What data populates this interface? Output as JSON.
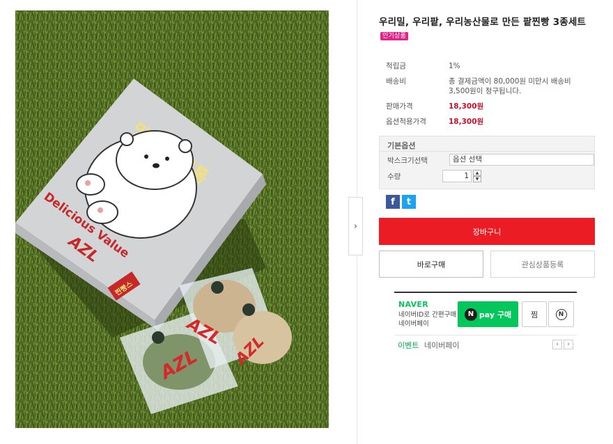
{
  "product": {
    "title": "우리밀, 우리팥, 우리농산물로 만든 팥찐빵 3종세트",
    "badge": "인기상품"
  },
  "specs": [
    {
      "label": "적립금",
      "value": "1%"
    },
    {
      "label": "배송비",
      "value": "총 결제금액이 80,000원 미만시 배송비 3,500원이 청구됩니다."
    },
    {
      "label": "판매가격",
      "value": "18,300원"
    },
    {
      "label": "옵션적용가격",
      "value": "18,300원"
    }
  ],
  "options": {
    "heading": "기본옵션",
    "box_label": "박스크기선택",
    "box_value": "옵션 선택",
    "qty_label": "수량",
    "qty_value": "1"
  },
  "share": {
    "facebook": "f",
    "twitter": "t"
  },
  "buttons": {
    "cart": "장바구니",
    "buy_now": "바로구매",
    "wishlist": "관심상품등록"
  },
  "naver": {
    "logo": "NAVER",
    "desc": "네이버ID로 간편구매 네이버페이",
    "npay_n": "N",
    "npay_label": "pay 구매",
    "jjim": "찜",
    "n_icon": "N",
    "event_label": "이벤트",
    "event_text": "네이버페이"
  },
  "photo": {
    "box_text_1": "맛있는 전통",
    "box_text_2": "Delicious Value",
    "brand": "AZL",
    "box_tag": "찐빵스"
  },
  "colors": {
    "accent_red": "#ec1c24",
    "price_red": "#c8102e",
    "naver_green": "#03c75a",
    "badge_pink": "#e4238a"
  }
}
